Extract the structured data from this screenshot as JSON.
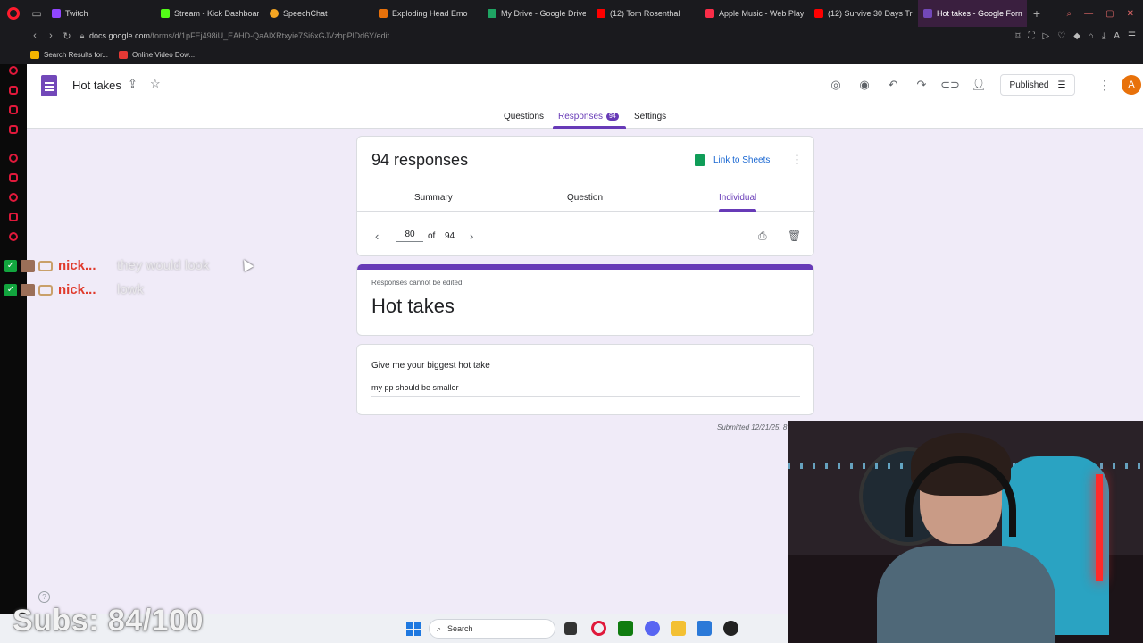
{
  "browser": {
    "tabs": [
      {
        "label": "Twitch",
        "color": "#9146ff"
      },
      {
        "label": "Stream - Kick Dashboard",
        "color": "#53fc18"
      },
      {
        "label": "SpeechChat",
        "color": "#f5a623"
      },
      {
        "label": "Exploding Head Emo",
        "color": "#e8710a"
      },
      {
        "label": "My Drive - Google Drive",
        "color": "#1fa463"
      },
      {
        "label": "(12) Tom Rosenthal",
        "color": "#ff0000"
      },
      {
        "label": "Apple Music - Web Play",
        "color": "#fa2d48"
      },
      {
        "label": "(12) Survive 30 Days Tr",
        "color": "#ff0000"
      },
      {
        "label": "Hot takes - Google Forms",
        "color": "#7248b9"
      }
    ],
    "url_host": "docs.google.com",
    "url_path": "/forms/d/1pFEj498iU_EAHD-QaAlXRtxyie7Si6xGJVzbpPlDd6Y/edit",
    "bookmarks": [
      {
        "label": "Search Results for...",
        "color": "#f4b400"
      },
      {
        "label": "Online Video Dow...",
        "color": "#e53935"
      }
    ]
  },
  "form": {
    "doc_title": "Hot takes",
    "nav": {
      "questions": "Questions",
      "responses": "Responses",
      "responses_count": "94",
      "settings": "Settings"
    },
    "published_label": "Published",
    "avatar_letter": "A",
    "responses_title": "94 responses",
    "link_sheets": "Link to Sheets",
    "subtabs": {
      "summary": "Summary",
      "question": "Question",
      "individual": "Individual"
    },
    "pager": {
      "current": "80",
      "of": "of",
      "total": "94"
    },
    "cannot_edit": "Responses cannot be edited",
    "form_title": "Hot takes",
    "question": "Give me your biggest hot take",
    "answer": "my pp should be smaller",
    "submitted": "Submitted 12/21/25, 8"
  },
  "stream": {
    "chat": [
      {
        "name": "nick...",
        "message": "they would look"
      },
      {
        "name": "nick...",
        "message": "lowk"
      }
    ],
    "subs_goal": "Subs: 84/100"
  },
  "taskbar": {
    "search_label": "Search"
  }
}
